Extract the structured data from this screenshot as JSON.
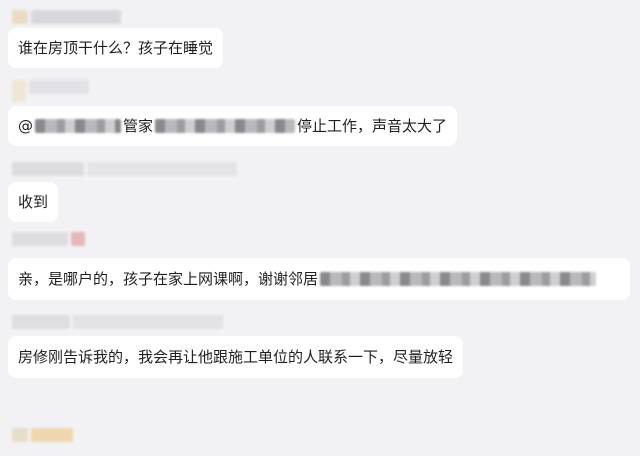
{
  "messages": [
    {
      "text": "谁在房顶干什么？孩子在睡觉"
    },
    {
      "at_symbol": "@",
      "name_suffix": "管家",
      "text_after": "停止工作，声音太大了"
    },
    {
      "text": "收到"
    },
    {
      "text": "亲，是哪户的，孩子在家上网课啊，谢谢邻居"
    },
    {
      "text": "房修刚告诉我的，我会再让他跟施工单位的人联系一下，尽量放轻"
    }
  ],
  "colors": {
    "background": "#f2f2f4",
    "bubble": "#ffffff",
    "text": "#1f1f1f"
  }
}
